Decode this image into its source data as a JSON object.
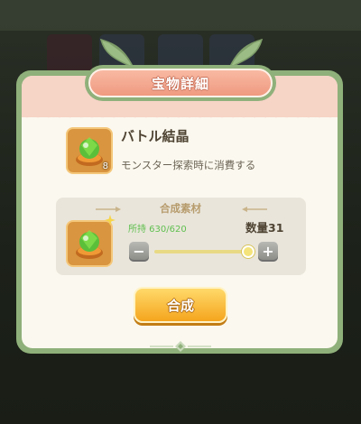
{
  "dialog": {
    "title": "宝物詳細",
    "item": {
      "name": "バトル結晶",
      "description": "モンスター探索時に消費する",
      "count": "8",
      "icon": "green-crystal-icon"
    },
    "materials": {
      "title": "合成素材",
      "icon": "green-crystal-icon",
      "owned": "所持 630/620",
      "quantity": "数量31",
      "slider_fraction": 1.0
    },
    "craft_label": "合成"
  },
  "colors": {
    "frame": "#8fb07a",
    "banner": "#ef9a80",
    "owned_text": "#5fbf4e",
    "craft_button": "#f5a51d"
  }
}
